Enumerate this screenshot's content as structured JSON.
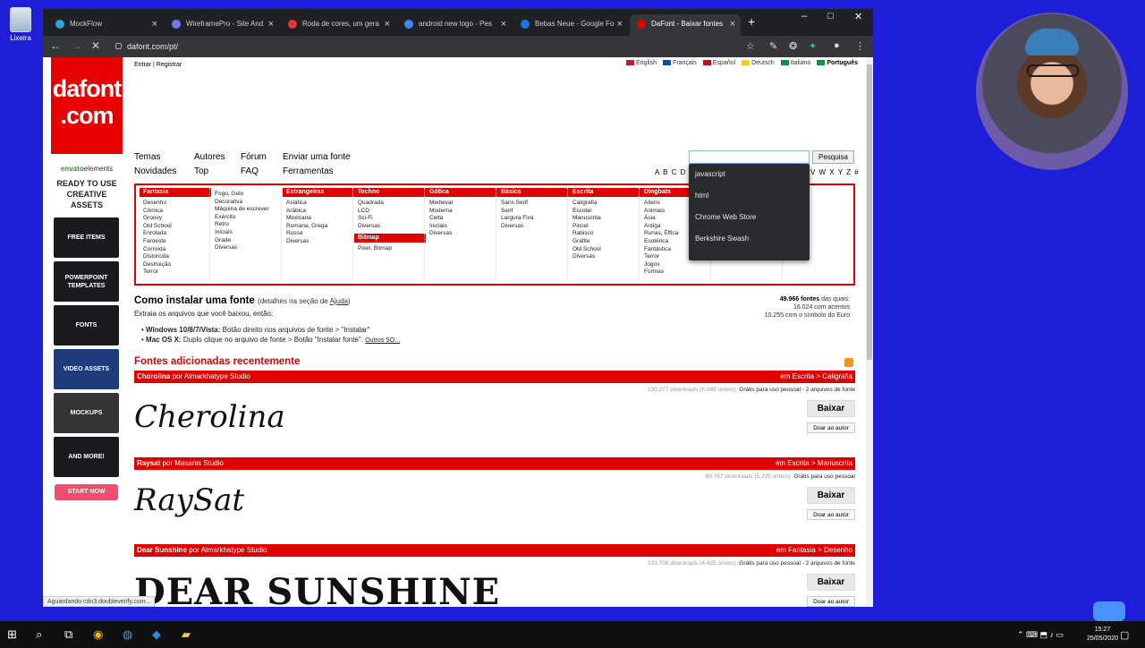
{
  "desktop": {
    "icon_label": "Lixeira"
  },
  "browser": {
    "tabs": [
      {
        "label": "MockFlow",
        "color": "#2aa3e0"
      },
      {
        "label": "WireframePro - Site And",
        "color": "#6c7bf5"
      },
      {
        "label": "Roda de cores, um gera",
        "color": "#e23b2e"
      },
      {
        "label": "android new logo - Pes",
        "color": "#4285f4"
      },
      {
        "label": "Bebas Neue - Google Fo",
        "color": "#1a73e8"
      },
      {
        "label": "DaFont - Baixar fontes",
        "color": "#e60000"
      }
    ],
    "new_tab": "+",
    "url": "dafont.com/pt/",
    "status": "Aguardando cdn3.doubleverify.com..."
  },
  "site": {
    "logo_line1": "dafont",
    "logo_line2": ".com",
    "login": "Entrar",
    "register": "Registrar",
    "languages": [
      {
        "label": "English",
        "color": "#b22234"
      },
      {
        "label": "Français",
        "color": "#0055a4"
      },
      {
        "label": "Español",
        "color": "#c60b1e"
      },
      {
        "label": "Deutsch",
        "color": "#ffce00"
      },
      {
        "label": "Italiano",
        "color": "#009246"
      },
      {
        "label": "Português",
        "color": "#009c3b"
      }
    ],
    "menu": [
      "Temas",
      "Autores",
      "Fórum",
      "Enviar uma fonte",
      "Novidades",
      "Top",
      "FAQ",
      "Ferramentas"
    ],
    "search_placeholder": "",
    "search_button": "Pesquisa",
    "alphabet_left": "A B C D E",
    "alphabet_right": "V W X Y Z #",
    "suggestions": [
      "javascript",
      "html",
      "Chrome Web Store",
      "Berkshire Swash"
    ],
    "categories": [
      {
        "title": "Fantasia",
        "items": [
          "Desenho",
          "Cômica",
          "Groovy",
          "Old School",
          "Enrolada",
          "Faroeste",
          "Corroída",
          "Distorcida",
          "Destruição",
          "Terror"
        ]
      },
      {
        "title": "",
        "items": [
          "Fogo, Gelo",
          "Decorativa",
          "Máquina de escrever",
          "Exército",
          "Retro",
          "Iniciais",
          "Grade",
          "Diversas"
        ]
      },
      {
        "title": "Estrangeiras",
        "items": [
          "Asiática",
          "Arábica",
          "Mexicana",
          "Romana, Grega",
          "Russa",
          "Diversas"
        ]
      },
      {
        "title": "Techno",
        "items": [
          "Quadrada",
          "LCD",
          "Sci-Fi",
          "Diversas"
        ],
        "title2": "Bitmap",
        "items2": [
          "Pixel, Bitmap"
        ]
      },
      {
        "title": "Gótica",
        "items": [
          "Medieval",
          "Moderna",
          "Celta",
          "Iniciais",
          "Diversas"
        ]
      },
      {
        "title": "Básica",
        "items": [
          "Sans Serif",
          "Serif",
          "Largura Fixa",
          "Diversas"
        ]
      },
      {
        "title": "Escrita",
        "items": [
          "Caligrafia",
          "Escolar",
          "Manuscrita",
          "Pincel",
          "Rabisco",
          "Grafite",
          "Old School",
          "Diversas"
        ]
      },
      {
        "title": "Dingbats",
        "items": [
          "Aliens",
          "Animais",
          "Ásia",
          "Antiga",
          "Runas, Élfica",
          "Esotérica",
          "Fantástica",
          "Terror",
          "Jogos",
          "Formas"
        ]
      },
      {
        "title": "",
        "items": [
          "",
          "",
          "",
          "",
          "",
          "",
          "",
          "Música",
          "Diversas"
        ]
      },
      {
        "title": "",
        "items": [
          "tos",
          "",
          "Bruxas"
        ]
      }
    ],
    "install": {
      "title": "Como instalar uma fonte",
      "note_prefix": "(detalhes na seção de ",
      "note_link": "Ajuda",
      "note_suffix": ")",
      "subtitle": "Extraia os arquivos que você baixou, então:",
      "win_label": "Windows 10/8/7/Vista:",
      "win_text": "Botão direito nos arquivos de fonte > \"Instalar\"",
      "mac_label": "Mac OS X:",
      "mac_text": "Duplo clique no arquivo de fonte > Botão \"Instalar fonte\".",
      "others": "Outros SO..."
    },
    "stats": {
      "total": "49.966 fontes",
      "total_suffix": "das quais:",
      "accents": "16.024 com acentos",
      "euro": "10.255 com o símbolo do Euro"
    },
    "recent_title": "Fontes adicionadas recentemente",
    "fonts": [
      {
        "name": "Chorolina",
        "author_prefix": "por",
        "author": "Almarkhatype Studio",
        "category": "em Escrita > Caligrafia",
        "downloads": "230.277 downloads (6.088 ontem)",
        "license": "Grátis para uso pessoal - 2 arquivos de fonte",
        "preview": "Cherolina",
        "download": "Baixar",
        "donate": "Doar ao autor"
      },
      {
        "name": "Raysat",
        "author_prefix": "por",
        "author": "Masanis Studio",
        "category": "em Escrita > Manuscrita",
        "downloads": "80.767 downloads (5.225 ontem)",
        "license": "Grátis para uso pessoal",
        "preview": "RaySat",
        "download": "Baixar",
        "donate": "Doar ao autor"
      },
      {
        "name": "Dear Sunshine",
        "author_prefix": "por",
        "author": "Almarkhatype Studio",
        "category": "em Fantasia > Desenho",
        "downloads": "233.706 downloads (4.435 ontem)",
        "license": "Grátis para uso pessoal - 2 arquivos de fonte",
        "preview": "DEAR SUNSHINE",
        "download": "Baixar",
        "donate": "Doar ao autor"
      }
    ],
    "ad": {
      "brand": "envato",
      "brand2": "elements",
      "headline": "READY TO USE CREATIVE ASSETS",
      "tiles": [
        "FREE ITEMS",
        "POWERPOINT TEMPLATES",
        "FONTS",
        "VIDEO ASSETS",
        "MOCKUPS",
        "AND MORE!"
      ],
      "cta": "START NOW"
    }
  },
  "taskbar": {
    "time": "15:27",
    "date": "25/05/2020"
  }
}
